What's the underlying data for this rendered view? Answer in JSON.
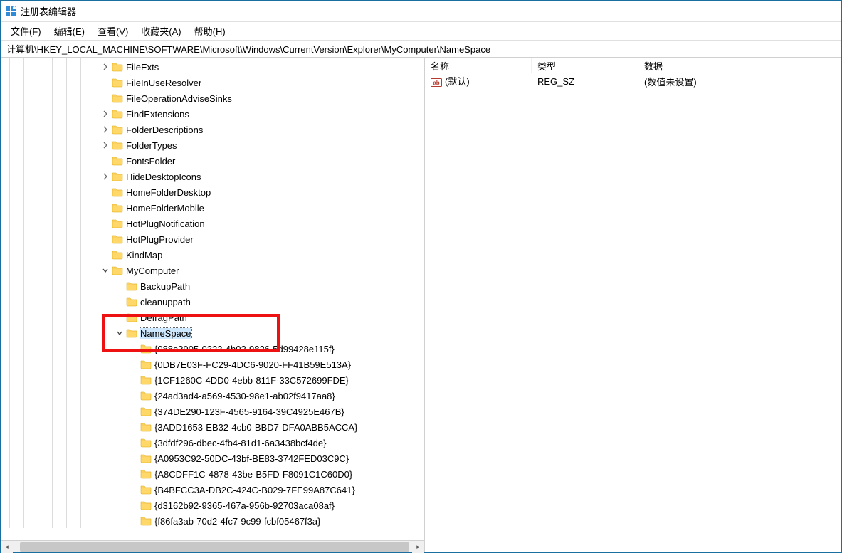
{
  "window": {
    "title": "注册表编辑器"
  },
  "menu": {
    "file": "文件(F)",
    "edit": "编辑(E)",
    "view": "查看(V)",
    "favorites": "收藏夹(A)",
    "help": "帮助(H)"
  },
  "address": {
    "path": "计算机\\HKEY_LOCAL_MACHINE\\SOFTWARE\\Microsoft\\Windows\\CurrentVersion\\Explorer\\MyComputer\\NameSpace"
  },
  "tree": {
    "items": [
      {
        "depth": 7,
        "exp": "closed",
        "label": "FileExts"
      },
      {
        "depth": 7,
        "exp": "none",
        "label": "FileInUseResolver"
      },
      {
        "depth": 7,
        "exp": "none",
        "label": "FileOperationAdviseSinks"
      },
      {
        "depth": 7,
        "exp": "closed",
        "label": "FindExtensions"
      },
      {
        "depth": 7,
        "exp": "closed",
        "label": "FolderDescriptions"
      },
      {
        "depth": 7,
        "exp": "closed",
        "label": "FolderTypes"
      },
      {
        "depth": 7,
        "exp": "none",
        "label": "FontsFolder"
      },
      {
        "depth": 7,
        "exp": "closed",
        "label": "HideDesktopIcons"
      },
      {
        "depth": 7,
        "exp": "none",
        "label": "HomeFolderDesktop"
      },
      {
        "depth": 7,
        "exp": "none",
        "label": "HomeFolderMobile"
      },
      {
        "depth": 7,
        "exp": "none",
        "label": "HotPlugNotification"
      },
      {
        "depth": 7,
        "exp": "none",
        "label": "HotPlugProvider"
      },
      {
        "depth": 7,
        "exp": "none",
        "label": "KindMap"
      },
      {
        "depth": 7,
        "exp": "open",
        "label": "MyComputer"
      },
      {
        "depth": 8,
        "exp": "none",
        "label": "BackupPath"
      },
      {
        "depth": 8,
        "exp": "none",
        "label": "cleanuppath"
      },
      {
        "depth": 8,
        "exp": "none",
        "label": "DefragPath"
      },
      {
        "depth": 8,
        "exp": "open",
        "label": "NameSpace",
        "selected": true
      },
      {
        "depth": 9,
        "exp": "none",
        "label": "{088e3905-0323-4b02-9826-5d99428e115f}"
      },
      {
        "depth": 9,
        "exp": "none",
        "label": "{0DB7E03F-FC29-4DC6-9020-FF41B59E513A}"
      },
      {
        "depth": 9,
        "exp": "none",
        "label": "{1CF1260C-4DD0-4ebb-811F-33C572699FDE}"
      },
      {
        "depth": 9,
        "exp": "none",
        "label": "{24ad3ad4-a569-4530-98e1-ab02f9417aa8}"
      },
      {
        "depth": 9,
        "exp": "none",
        "label": "{374DE290-123F-4565-9164-39C4925E467B}"
      },
      {
        "depth": 9,
        "exp": "none",
        "label": "{3ADD1653-EB32-4cb0-BBD7-DFA0ABB5ACCA}"
      },
      {
        "depth": 9,
        "exp": "none",
        "label": "{3dfdf296-dbec-4fb4-81d1-6a3438bcf4de}"
      },
      {
        "depth": 9,
        "exp": "none",
        "label": "{A0953C92-50DC-43bf-BE83-3742FED03C9C}"
      },
      {
        "depth": 9,
        "exp": "none",
        "label": "{A8CDFF1C-4878-43be-B5FD-F8091C1C60D0}"
      },
      {
        "depth": 9,
        "exp": "none",
        "label": "{B4BFCC3A-DB2C-424C-B029-7FE99A87C641}"
      },
      {
        "depth": 9,
        "exp": "none",
        "label": "{d3162b92-9365-467a-956b-92703aca08af}"
      },
      {
        "depth": 9,
        "exp": "none",
        "label": "{f86fa3ab-70d2-4fc7-9c99-fcbf05467f3a}"
      }
    ]
  },
  "list": {
    "headers": {
      "name": "名称",
      "type": "类型",
      "data": "数据"
    },
    "rows": [
      {
        "name": "(默认)",
        "type": "REG_SZ",
        "data": "(数值未设置)"
      }
    ]
  },
  "icons": {
    "value_badge": "ab"
  }
}
